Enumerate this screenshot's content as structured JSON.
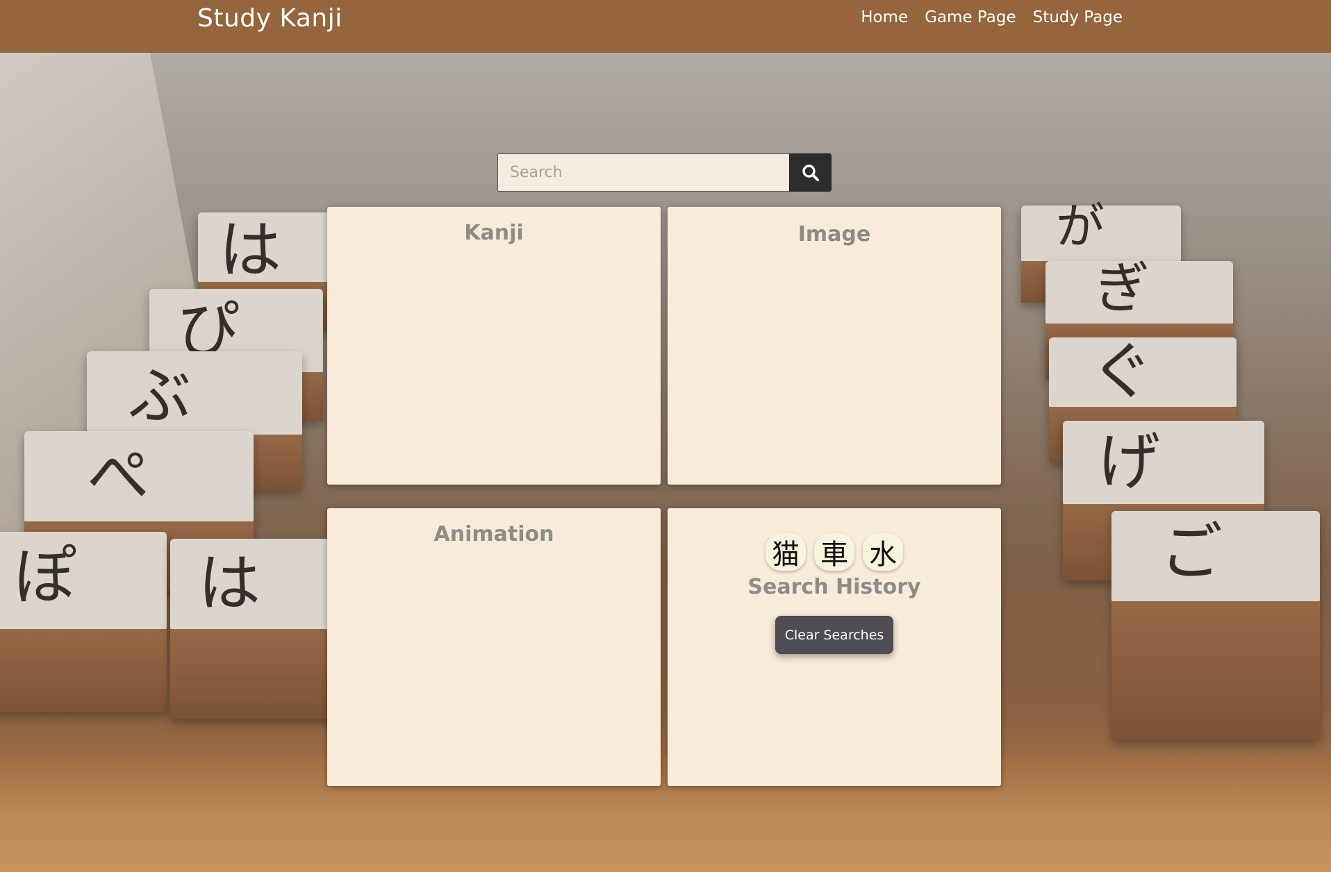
{
  "navbar": {
    "brand": "Study Kanji",
    "links": [
      {
        "label": "Home"
      },
      {
        "label": "Game Page"
      },
      {
        "label": "Study Page"
      }
    ],
    "color": "#95653b"
  },
  "search": {
    "placeholder": "Search",
    "value": "",
    "icon": "search-icon"
  },
  "cards": {
    "kanji": {
      "title": "Kanji"
    },
    "image": {
      "title": "Image"
    },
    "animation": {
      "title": "Animation"
    },
    "history": {
      "title": "Search History",
      "items": [
        "猫",
        "車",
        "水"
      ],
      "clear_label": "Clear Searches"
    }
  },
  "background": {
    "kana_blocks": [
      "は",
      "ぴ",
      "ぶ",
      "ぺ",
      "ぽ",
      "は",
      "が",
      "ぎ",
      "ぐ",
      "げ",
      "ご"
    ]
  },
  "colors": {
    "card_bg": "#f9ebd9",
    "card_title": "#8f8b86",
    "button_dark": "#4d4d52",
    "search_bg": "#f6ebe0"
  }
}
